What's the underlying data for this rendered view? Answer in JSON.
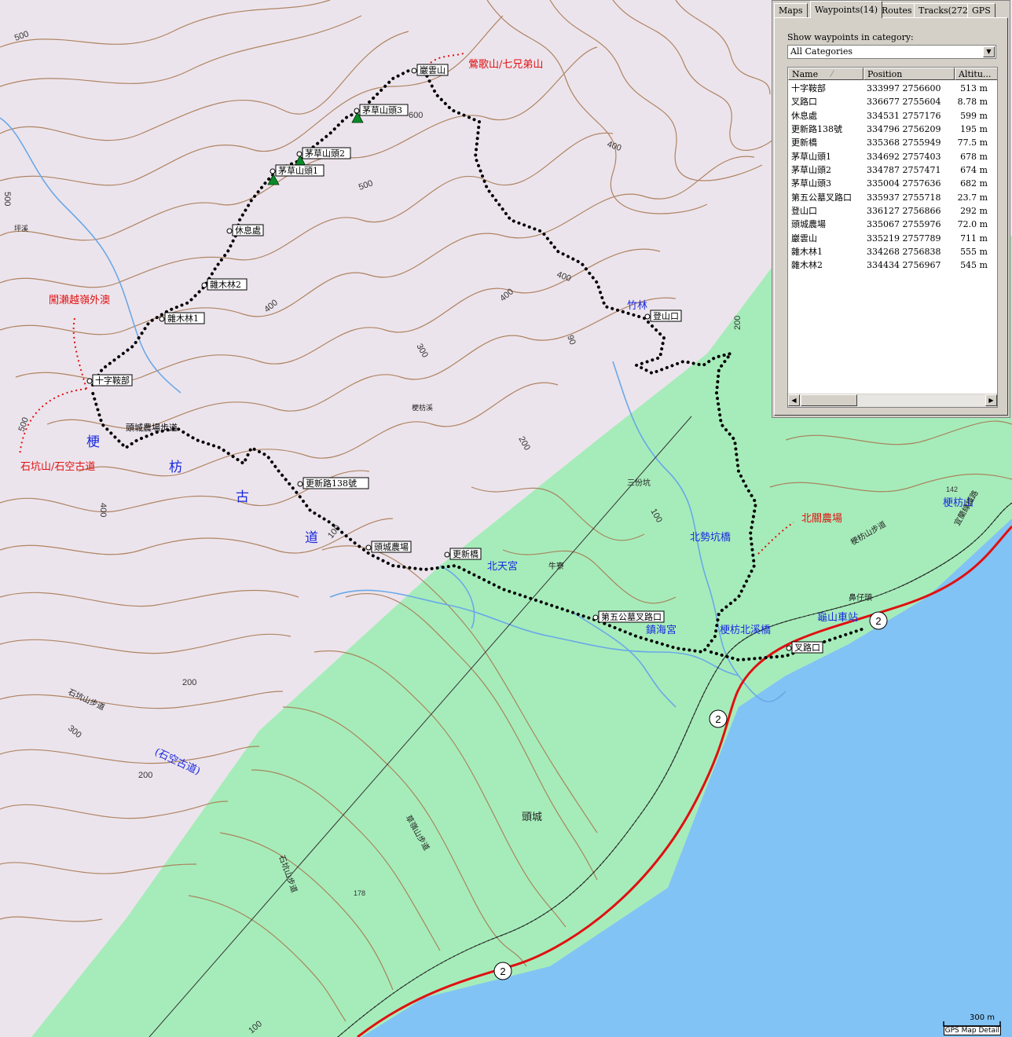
{
  "panel": {
    "tabs": [
      "Maps",
      "Waypoints(14)",
      "Routes",
      "Tracks(272)",
      "GPS"
    ],
    "active_tab": "Waypoints(14)",
    "category_label": "Show waypoints in category:",
    "category_value": "All Categories",
    "columns": [
      "Name",
      "Position",
      "Altitu..."
    ],
    "waypoints": [
      {
        "name": "十字鞍部",
        "position": "333997 2756600",
        "altitude": "513 m"
      },
      {
        "name": "叉路口",
        "position": "336677 2755604",
        "altitude": "8.78 m"
      },
      {
        "name": "休息處",
        "position": "334531 2757176",
        "altitude": "599 m"
      },
      {
        "name": "更新路138號",
        "position": "334796 2756209",
        "altitude": "195 m"
      },
      {
        "name": "更新橋",
        "position": "335368 2755949",
        "altitude": "77.5 m"
      },
      {
        "name": "茅草山頭1",
        "position": "334692 2757403",
        "altitude": "678 m"
      },
      {
        "name": "茅草山頭2",
        "position": "334787 2757471",
        "altitude": "674 m"
      },
      {
        "name": "茅草山頭3",
        "position": "335004 2757636",
        "altitude": "682 m"
      },
      {
        "name": "第五公墓叉路口",
        "position": "335937 2755718",
        "altitude": "23.7 m"
      },
      {
        "name": "登山口",
        "position": "336127 2756866",
        "altitude": "292 m"
      },
      {
        "name": "頭城農場",
        "position": "335067 2755976",
        "altitude": "72.0 m"
      },
      {
        "name": "巖雲山",
        "position": "335219 2757789",
        "altitude": "711 m"
      },
      {
        "name": "雜木林1",
        "position": "334268 2756838",
        "altitude": "555 m"
      },
      {
        "name": "雜木林2",
        "position": "334434 2756967",
        "altitude": "545 m"
      }
    ]
  },
  "map": {
    "waypoint_labels": [
      "巖雲山",
      "茅草山頭3",
      "茅草山頭2",
      "茅草山頭1",
      "休息處",
      "雜木林2",
      "雜木林1",
      "十字鞍部",
      "頭城農場步道",
      "更新路138號",
      "頭城農場",
      "更新橋",
      "第五公墓叉路口",
      "登山口",
      "叉路口"
    ],
    "red_labels": [
      "石坑山/石空古道",
      "鶯歌山/七兄弟山",
      "闖瀨越嶺外澳",
      "北關農場"
    ],
    "blue_labels": [
      "梗",
      "枋",
      "古",
      "道",
      "北天宮",
      "鎮海宮",
      "梗枋北溪橋",
      "北勢坑橋",
      "龜山車站",
      "梗枋山",
      "竹林",
      "(石空古道)"
    ],
    "dark_labels": [
      "頭城",
      "三份坑",
      "牛寮",
      "梗枋溪",
      "坪溪",
      "石坑山步道",
      "梗枋山步道",
      "宜蘭線鐵路",
      "草嶺山步道",
      "石坑山步道",
      "鼻仔頭"
    ],
    "contour_labels": [
      "500",
      "500",
      "600",
      "500",
      "400",
      "400",
      "400",
      "400",
      "300",
      "300",
      "200",
      "200",
      "200",
      "100",
      "100",
      "100",
      "200",
      "500",
      "400",
      "90"
    ],
    "spot_heights": [
      "142",
      "178"
    ],
    "highway_number": "2",
    "scale": "300 m",
    "credit": "GPS Map Detail"
  },
  "colors": {
    "mountain": "#ece4ec",
    "lowland": "#a6ecba",
    "sea": "#82c3f5",
    "contour": "#a87a55",
    "river": "#6aa8e8",
    "highway": "#e01010",
    "track": "#000000"
  }
}
